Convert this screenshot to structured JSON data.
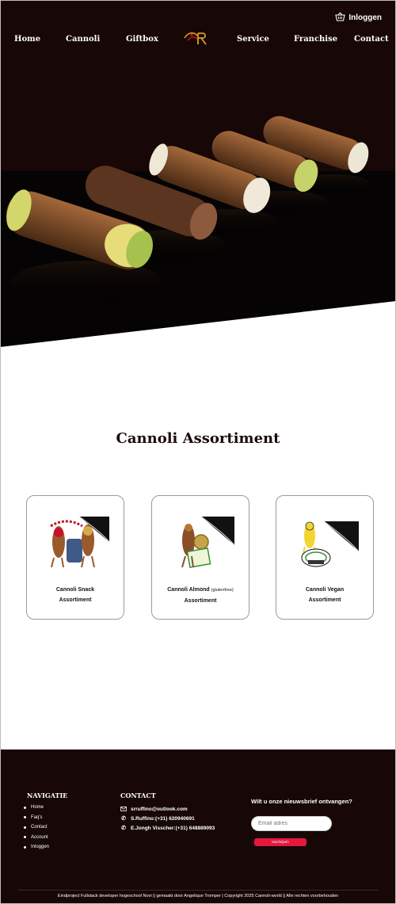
{
  "header": {
    "login_label": "Inloggen",
    "nav": [
      "Home",
      "Cannoli",
      "Giftbox",
      "Service",
      "Franchise",
      "Contact"
    ]
  },
  "main": {
    "title": "Cannoli Assortiment",
    "cards": [
      {
        "line1": "Cannoli Snack",
        "note": "",
        "line2": "Assortiment"
      },
      {
        "line1": "Cannoli Almond",
        "note": "(glutenfree)",
        "line2": "Assortiment"
      },
      {
        "line1": "Cannoli Vegan",
        "note": "",
        "line2": "Assortiment"
      }
    ]
  },
  "footer": {
    "nav_title": "NAVIGATIE",
    "nav_items": [
      "Home",
      "Faq's",
      "Contact",
      "Account",
      "Inloggen"
    ],
    "contact_title": "CONTACT",
    "email": "srruffino@outlook.com",
    "phone1": "S.Ruffino:(+31) 620940691",
    "phone2": "E.Jongh Visscher:(+31) 648889093",
    "newsletter_question": "Wilt u onze nieuwsbrief ontvangen?",
    "email_placeholder": "Email adres",
    "subscribe_label": "Inschrijven",
    "copyright": "Eindproject Fullstack developer hogeschool Novi  ||  gemaakt door Angelique Tromper |  Copyright  2025 Cannoli-world ||  Alle rechten voorbehouden"
  },
  "colors": {
    "header_bg": "#170707",
    "footer_bg": "#170707",
    "accent": "#e4173f"
  },
  "icons": [
    "basket-icon",
    "logo",
    "mail-icon",
    "phone-icon"
  ]
}
